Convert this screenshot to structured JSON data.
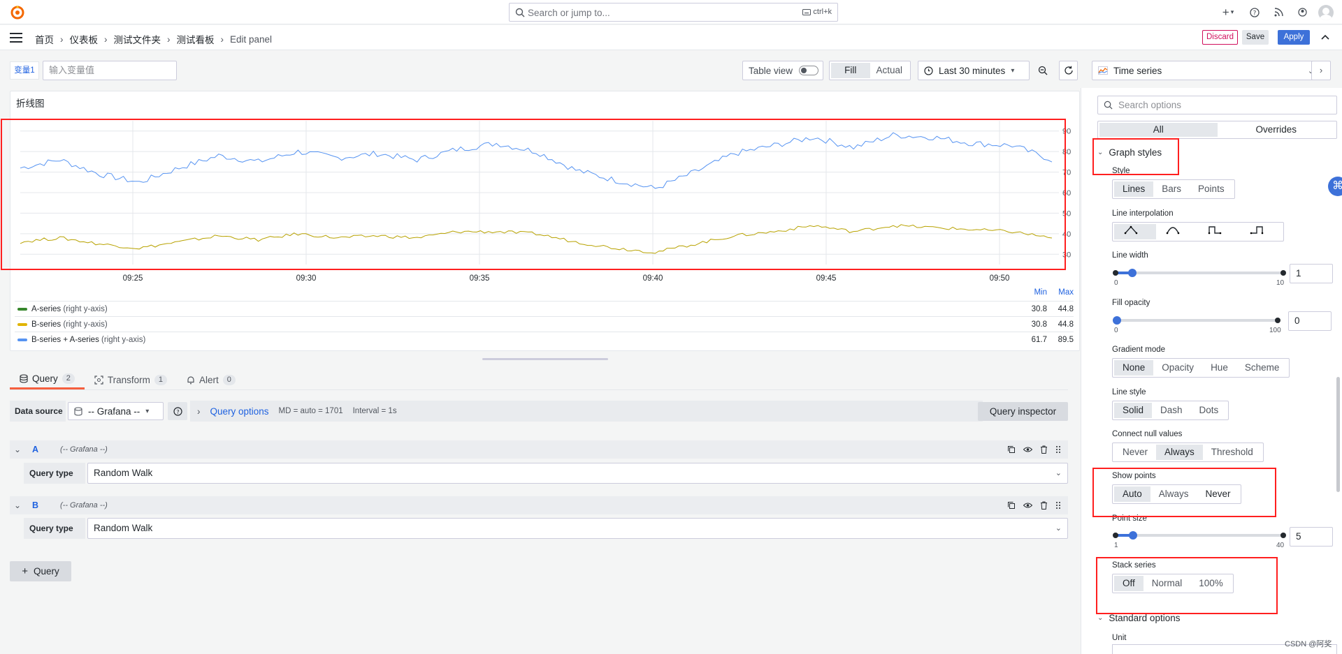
{
  "topbar": {
    "search_placeholder": "Search or jump to...",
    "search_shortcut": "ctrl+k",
    "add_label": "+"
  },
  "breadcrumb": [
    "首页",
    "仪表板",
    "测试文件夹",
    "测试看板",
    "Edit panel"
  ],
  "actions": {
    "discard": "Discard",
    "save": "Save",
    "apply": "Apply"
  },
  "variable": {
    "label": "变量1",
    "placeholder": "输入变量值"
  },
  "toolbar": {
    "table_view": "Table view",
    "fill": "Fill",
    "actual": "Actual",
    "time_range": "Last 30 minutes"
  },
  "panel": {
    "title": "折线图",
    "legend": {
      "headers": [
        "Min",
        "Max"
      ],
      "rows": [
        {
          "name": "A-series",
          "axis": "(right y-axis)",
          "color": "#37872d",
          "min": "30.8",
          "max": "44.8"
        },
        {
          "name": "B-series",
          "axis": "(right y-axis)",
          "color": "#e0b400",
          "min": "30.8",
          "max": "44.8"
        },
        {
          "name": "B-series + A-series",
          "axis": "(right y-axis)",
          "color": "#5794f2",
          "min": "61.7",
          "max": "89.5"
        }
      ]
    }
  },
  "chart_data": {
    "type": "line",
    "title": "折线图",
    "x_ticks": [
      "09:25",
      "09:30",
      "09:35",
      "09:40",
      "09:45",
      "09:50"
    ],
    "y_ticks": [
      30,
      40,
      50,
      60,
      70,
      80,
      90
    ],
    "ylim": [
      25,
      95
    ],
    "y_axis_side": "right",
    "series": [
      {
        "name": "B-series + A-series",
        "color": "#5794f2",
        "values": [
          72,
          76,
          69,
          65,
          72,
          78,
          75,
          80,
          77,
          79,
          76,
          81,
          84,
          80,
          71,
          66,
          62,
          70,
          79,
          83,
          87,
          82,
          88,
          87,
          84,
          83,
          76
        ]
      },
      {
        "name": "B-series",
        "color": "#b8a200",
        "values": [
          36,
          38,
          35,
          33,
          36,
          39,
          37,
          40,
          38,
          39,
          38,
          41,
          41,
          40,
          36,
          33,
          31,
          35,
          39,
          41,
          44,
          41,
          44,
          43,
          42,
          41,
          38
        ]
      }
    ],
    "grid": true,
    "legend_position": "bottom"
  },
  "query_tabs": [
    {
      "label": "Query",
      "count": "2"
    },
    {
      "label": "Transform",
      "count": "1"
    },
    {
      "label": "Alert",
      "count": "0"
    }
  ],
  "datasource": {
    "label": "Data source",
    "value": "-- Grafana --",
    "query_options": "Query options",
    "md": "MD = auto = 1701",
    "interval": "Interval = 1s",
    "inspector": "Query inspector"
  },
  "queries": [
    {
      "ref": "A",
      "ds": "(-- Grafana --)",
      "type_label": "Query type",
      "type_value": "Random Walk"
    },
    {
      "ref": "B",
      "ds": "(-- Grafana --)",
      "type_label": "Query type",
      "type_value": "Random Walk"
    }
  ],
  "add_query": "Query",
  "options": {
    "vis": "Time series",
    "search_placeholder": "Search options",
    "tabs": [
      "All",
      "Overrides"
    ],
    "graph_styles": "Graph styles",
    "style_label": "Style",
    "style_opts": [
      "Lines",
      "Bars",
      "Points"
    ],
    "interp_label": "Line interpolation",
    "line_width_label": "Line width",
    "line_width": {
      "min": "0",
      "max": "10",
      "value": "1"
    },
    "fill_opacity_label": "Fill opacity",
    "fill_opacity": {
      "min": "0",
      "max": "100",
      "value": "0"
    },
    "gradient_label": "Gradient mode",
    "gradient_opts": [
      "None",
      "Opacity",
      "Hue",
      "Scheme"
    ],
    "line_style_label": "Line style",
    "line_style_opts": [
      "Solid",
      "Dash",
      "Dots"
    ],
    "connect_label": "Connect null values",
    "connect_opts": [
      "Never",
      "Always",
      "Threshold"
    ],
    "show_points_label": "Show points",
    "show_points_opts": [
      "Auto",
      "Always",
      "Never"
    ],
    "point_size_label": "Point size",
    "point_size": {
      "min": "1",
      "max": "40",
      "value": "5"
    },
    "stack_label": "Stack series",
    "stack_opts": [
      "Off",
      "Normal",
      "100%"
    ],
    "standard_options": "Standard options",
    "unit_label": "Unit"
  },
  "watermark": "CSDN @阿奖"
}
